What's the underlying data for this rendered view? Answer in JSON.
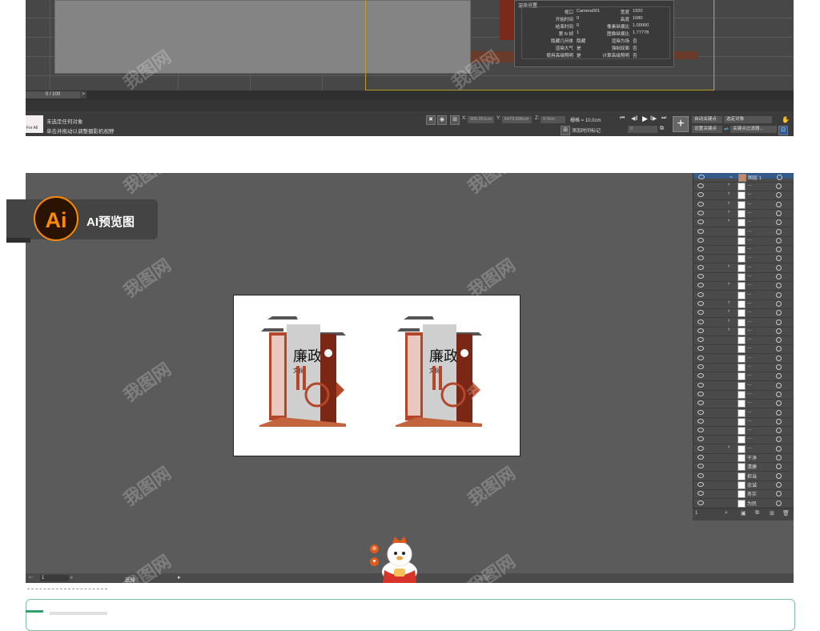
{
  "max": {
    "timeline_counter": "0 / 100",
    "render_dialog": {
      "title": "渲染设置",
      "rows": [
        {
          "left_label": "视口",
          "left_value": "Camera001",
          "right_label": "宽度",
          "right_value": "1920"
        },
        {
          "left_label": "开始时间",
          "left_value": "0",
          "right_label": "高度",
          "right_value": "1080"
        },
        {
          "left_label": "结束时间",
          "left_value": "0",
          "right_label": "像素纵横比",
          "right_value": "1.00000"
        },
        {
          "left_label": "第 N 帧",
          "left_value": "1",
          "right_label": "图像纵横比",
          "right_value": "1.77778"
        },
        {
          "left_label": "隐藏几何体",
          "left_value": "隐藏",
          "right_label": "渲染为场",
          "right_value": "否"
        },
        {
          "left_label": "渲染大气",
          "left_value": "是",
          "right_label": "强制双面",
          "right_value": "否"
        },
        {
          "left_label": "使用高级照明",
          "left_value": "是",
          "right_label": "计算高级照明",
          "right_value": "否"
        }
      ]
    },
    "status": {
      "line1": "未选定任何对象",
      "line2": "单击并拖动以调整摄影机视野",
      "script_label": "For All"
    },
    "coords": {
      "x": "906.951cm",
      "y": "6473.696cm",
      "z": "0.0cm",
      "grid": "栅格 = 10.0cm"
    },
    "add_time_tag": "添加时间标记",
    "auto_key": "自动关键点",
    "selected_object": "选定对象",
    "set_key": "设置关键点",
    "key_filters": "关键点过滤器...",
    "frame_value": "0"
  },
  "ai": {
    "badge_logo": "Ai",
    "badge_label": "AI预览图",
    "zoom": "1",
    "tool_status": "选择",
    "layers": {
      "top_layer": "图层 1",
      "count": "1",
      "named_rows": [
        "干净",
        "清廉",
        "担当",
        "忠诚",
        "务实",
        "为民"
      ]
    },
    "artwork": {
      "title": "廉政",
      "subtitle": "文化"
    }
  },
  "watermark": "我图网"
}
